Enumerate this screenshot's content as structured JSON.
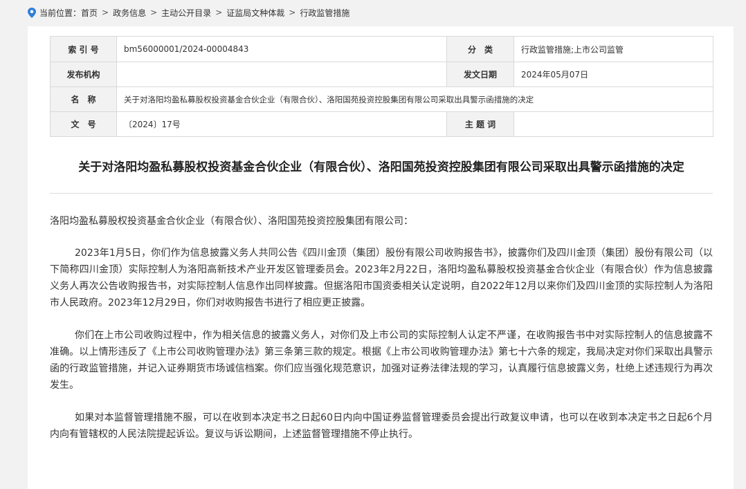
{
  "breadcrumb": {
    "prefix": "当前位置：",
    "items": [
      "首页",
      "政务信息",
      "主动公开目录",
      "证监局文种体裁",
      "行政监管措施"
    ],
    "separator": ">"
  },
  "meta": {
    "index_label": "索 引 号",
    "index_value": "bm56000001/2024-00004843",
    "category_label": "分　类",
    "category_value": "行政监管措施;上市公司监管",
    "issuer_label": "发布机构",
    "issuer_value": "",
    "date_label": "发文日期",
    "date_value": "2024年05月07日",
    "name_label": "名　称",
    "name_value": "关于对洛阳均盈私募股权投资基金合伙企业（有限合伙）、洛阳国苑投资控股集团有限公司采取出具警示函措施的决定",
    "docno_label": "文　号",
    "docno_value": "〔2024〕17号",
    "keywords_label": "主 题 词",
    "keywords_value": ""
  },
  "document": {
    "title": "关于对洛阳均盈私募股权投资基金合伙企业（有限合伙）、洛阳国苑投资控股集团有限公司采取出具警示函措施的决定",
    "salutation": "洛阳均盈私募股权投资基金合伙企业（有限合伙）、洛阳国苑投资控股集团有限公司：",
    "paragraphs": [
      "2023年1月5日，你们作为信息披露义务人共同公告《四川金顶（集团）股份有限公司收购报告书》，披露你们及四川金顶（集团）股份有限公司（以下简称四川金顶）实际控制人为洛阳高新技术产业开发区管理委员会。2023年2月22日，洛阳均盈私募股权投资基金合伙企业（有限合伙）作为信息披露义务人再次公告收购报告书，对实际控制人信息作出同样披露。但据洛阳市国资委相关认定说明，自2022年12月以来你们及四川金顶的实际控制人为洛阳市人民政府。2023年12月29日，你们对收购报告书进行了相应更正披露。",
      "你们在上市公司收购过程中，作为相关信息的披露义务人，对你们及上市公司的实际控制人认定不严谨，在收购报告书中对实际控制人的信息披露不准确。以上情形违反了《上市公司收购管理办法》第三条第三款的规定。根据《上市公司收购管理办法》第七十六条的规定，我局决定对你们采取出具警示函的行政监管措施，并记入证券期货市场诚信档案。你们应当强化规范意识，加强对证券法律法规的学习，认真履行信息披露义务，杜绝上述违规行为再次发生。",
      "如果对本监督管理措施不服，可以在收到本决定书之日起60日内向中国证券监督管理委员会提出行政复议申请，也可以在收到本决定书之日起6个月内向有管辖权的人民法院提起诉讼。复议与诉讼期间，上述监督管理措施不停止执行。"
    ]
  },
  "colors": {
    "page_bg": "#f2f2f2",
    "label_bg": "#f2f2f2",
    "border": "#d9d9d9",
    "pin_icon": "#2f7fd8"
  },
  "icons": {
    "location": "location-pin-icon"
  }
}
